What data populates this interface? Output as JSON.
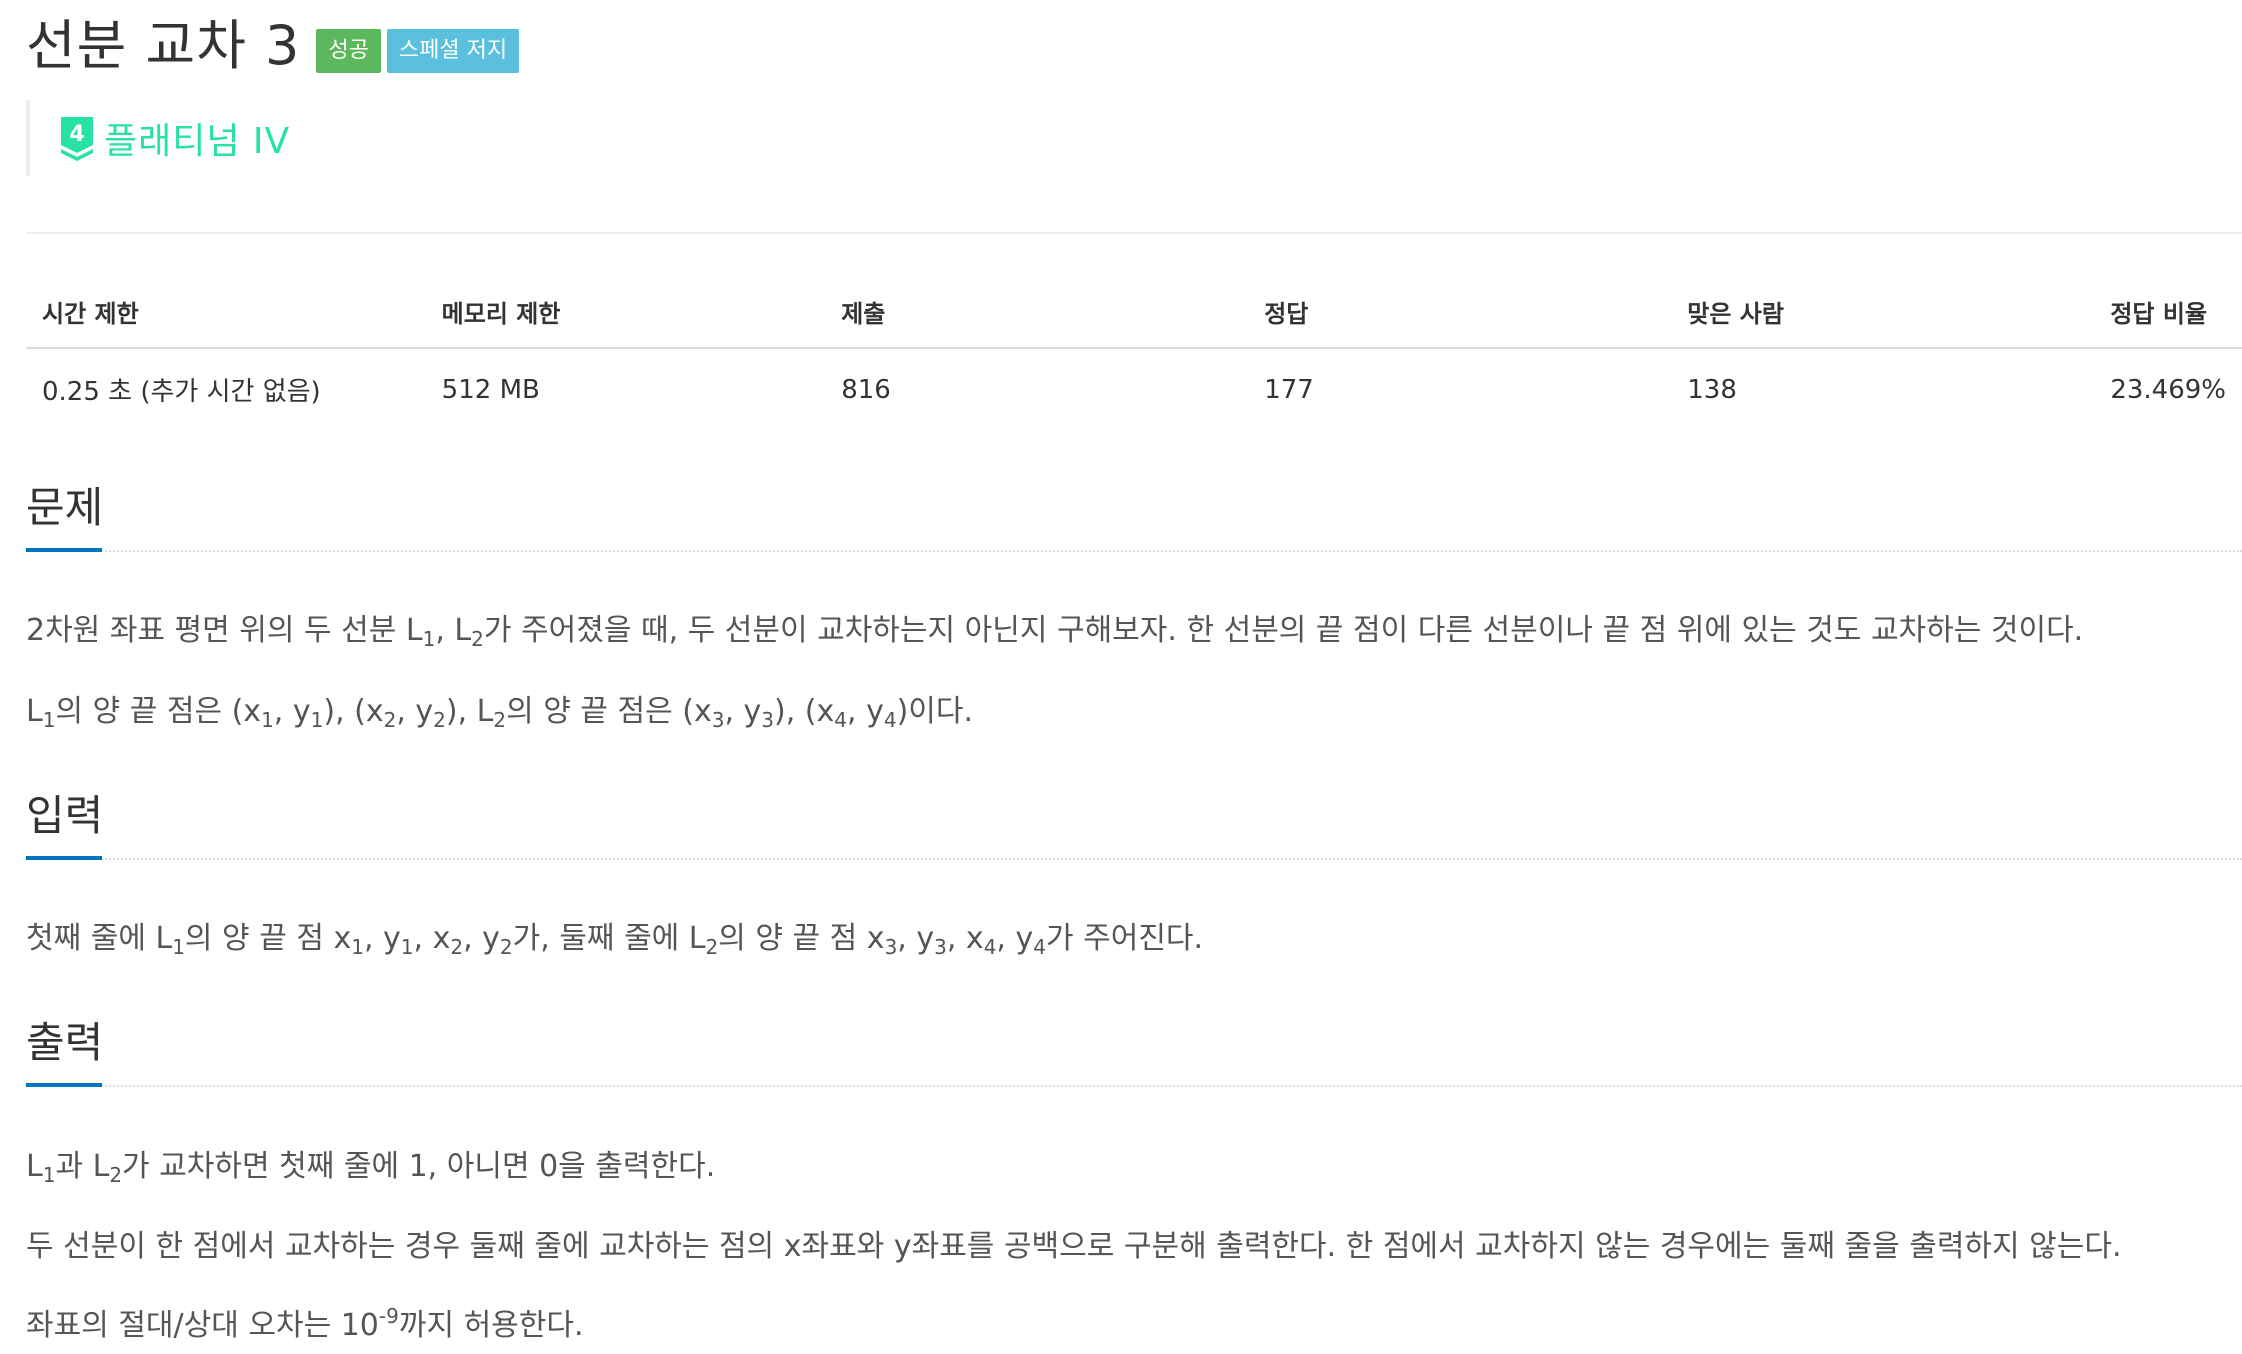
{
  "header": {
    "title": "선분 교차 3",
    "badges": [
      {
        "label": "성공",
        "color": "#5cb85c"
      },
      {
        "label": "스페셜 저지",
        "color": "#5bc0de"
      }
    ],
    "tier": {
      "icon_number": "4",
      "label": "플래티넘 IV",
      "color": "#27e2a4"
    }
  },
  "info_table": {
    "headers": [
      "시간 제한",
      "메모리 제한",
      "제출",
      "정답",
      "맞은 사람",
      "정답 비율"
    ],
    "values": [
      "0.25 초 (추가 시간 없음)",
      "512 MB",
      "816",
      "177",
      "138",
      "23.469%"
    ]
  },
  "sections": {
    "problem": {
      "title": "문제",
      "p1": {
        "a": "2차원 좌표 평면 위의 두 선분 L",
        "sub_a": "1",
        "b": ", L",
        "sub_b": "2",
        "c": "가 주어졌을 때, 두 선분이 교차하는지 아닌지 구해보자. 한 선분의 끝 점이 다른 선분이나 끝 점 위에 있는 것도 교차하는 것이다."
      },
      "p2": {
        "a": "L",
        "s1": "1",
        "b": "의 양 끝 점은 (x",
        "s2": "1",
        "c": ", y",
        "s3": "1",
        "d": "), (x",
        "s4": "2",
        "e": ", y",
        "s5": "2",
        "f": "), L",
        "s6": "2",
        "g": "의 양 끝 점은 (x",
        "s7": "3",
        "h": ", y",
        "s8": "3",
        "i": "), (x",
        "s9": "4",
        "j": ", y",
        "s10": "4",
        "k": ")이다."
      }
    },
    "input": {
      "title": "입력",
      "p1": {
        "a": "첫째 줄에 L",
        "s1": "1",
        "b": "의 양 끝 점 x",
        "s2": "1",
        "c": ", y",
        "s3": "1",
        "d": ", x",
        "s4": "2",
        "e": ", y",
        "s5": "2",
        "f": "가, 둘째 줄에 L",
        "s6": "2",
        "g": "의 양 끝 점 x",
        "s7": "3",
        "h": ", y",
        "s8": "3",
        "i": ", x",
        "s9": "4",
        "j": ", y",
        "s10": "4",
        "k": "가 주어진다."
      }
    },
    "output": {
      "title": "출력",
      "p1": {
        "a": "L",
        "s1": "1",
        "b": "과 L",
        "s2": "2",
        "c": "가 교차하면 첫째 줄에 1, 아니면 0을 출력한다."
      },
      "p2": "두 선분이 한 점에서 교차하는 경우 둘째 줄에 교차하는 점의 x좌표와 y좌표를 공백으로 구분해 출력한다. 한 점에서 교차하지 않는 경우에는 둘째 줄을 출력하지 않는다.",
      "p3": {
        "a": "좌표의 절대/상대 오차는 10",
        "sup": "-9",
        "b": "까지 허용한다."
      }
    }
  }
}
